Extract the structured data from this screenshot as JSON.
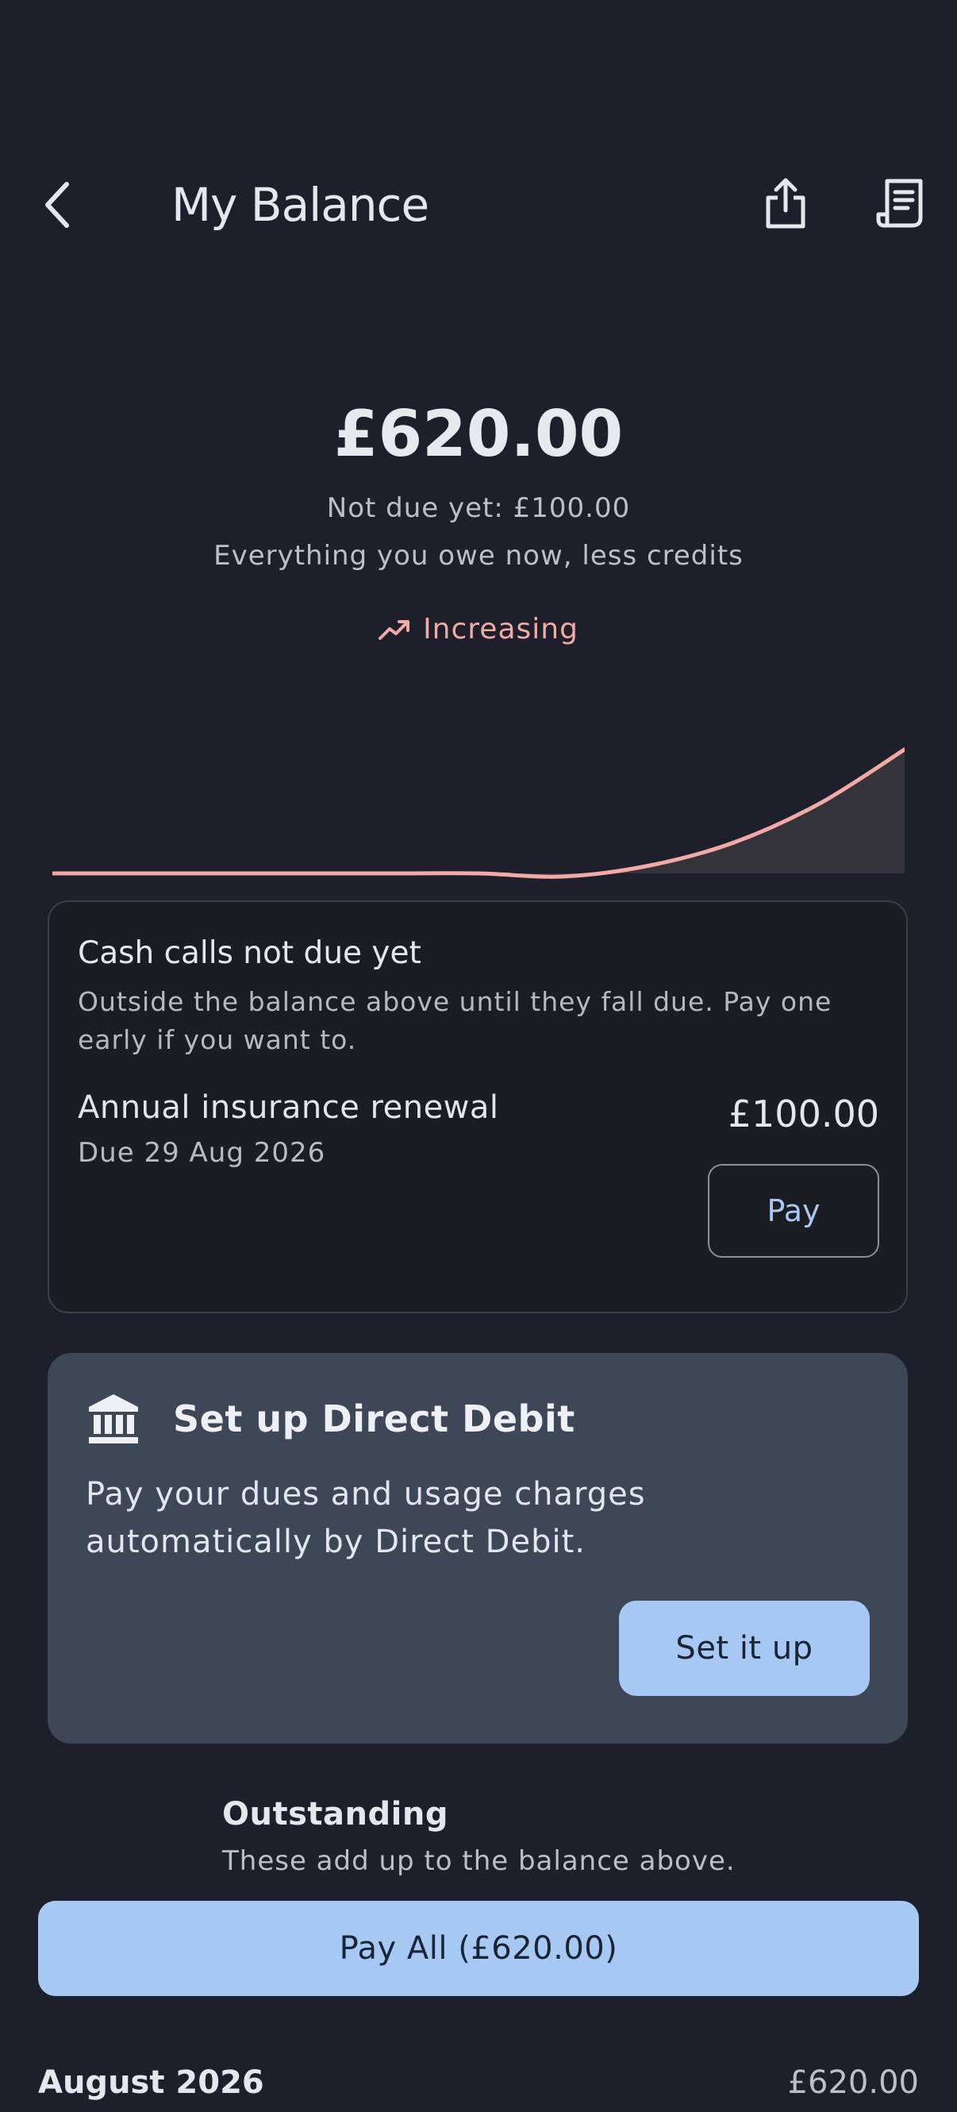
{
  "header": {
    "title": "My Balance",
    "back_icon": "chevron-left-icon",
    "share_icon": "share-icon",
    "receipt_icon": "receipt-icon"
  },
  "balance": {
    "amount": "£620.00",
    "not_due_text": "Not due yet: £100.00",
    "description": "Everything you owe now, less credits",
    "trend_label": "Increasing",
    "trend_color": "#f2aaa6"
  },
  "chart_data": {
    "type": "area",
    "x": [
      0,
      1,
      2,
      3,
      4,
      5,
      6,
      7,
      8,
      9,
      10
    ],
    "y": [
      0,
      0,
      0,
      0,
      0,
      0,
      -2,
      5,
      20,
      45,
      80
    ],
    "line_color": "#f2aaa6",
    "fill_color": "#34323a"
  },
  "not_due_card": {
    "title": "Cash calls not due yet",
    "description": "Outside the balance above until they fall due. Pay one early if you want to.",
    "item_name": "Annual insurance renewal",
    "item_due": "Due 29 Aug 2026",
    "item_amount": "£100.00",
    "pay_label": "Pay"
  },
  "direct_debit": {
    "icon": "bank-icon",
    "title": "Set up Direct Debit",
    "description": "Pay your dues and usage charges automatically by Direct Debit.",
    "button_label": "Set it up"
  },
  "outstanding": {
    "title": "Outstanding",
    "description": "These add up to the balance above."
  },
  "pay_all_label": "Pay All (£620.00)",
  "month_row": {
    "label": "August 2026",
    "amount": "£620.00"
  },
  "colors": {
    "background": "#1d202a",
    "accent": "#a8c8f4",
    "card_dark": "#1b1d23",
    "card_blue": "#3e4757"
  }
}
